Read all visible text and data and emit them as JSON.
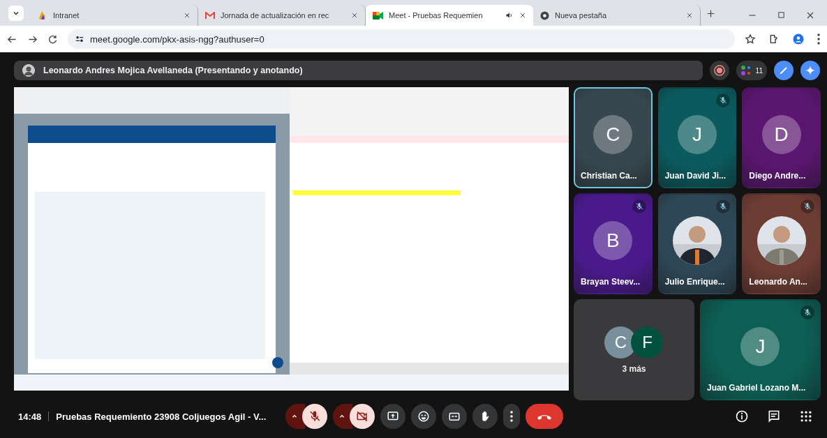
{
  "browser": {
    "tabs": [
      {
        "title": "Intranet",
        "selected": false,
        "audio": false
      },
      {
        "title": "Jornada de actualización en rec",
        "selected": false,
        "audio": false
      },
      {
        "title": "Meet - Pruebas Requemien",
        "selected": true,
        "audio": true
      },
      {
        "title": "Nueva pestaña",
        "selected": false,
        "audio": false
      }
    ],
    "url": "meet.google.com/pkx-asis-ngg?authuser=0"
  },
  "presenter_bar": {
    "text": "Leonardo Andres Mojica Avellaneda (Presentando y anotando)",
    "participant_count": "11"
  },
  "tiles": [
    {
      "name": "Christian Ca...",
      "kind": "avatar",
      "initial": "C",
      "color": "#37474f",
      "muted": false,
      "speaking": true
    },
    {
      "name": "Juan David Ji...",
      "kind": "avatar",
      "initial": "J",
      "color": "#0b5a5e",
      "muted": true,
      "speaking": false
    },
    {
      "name": "Diego Andre...",
      "kind": "avatar",
      "initial": "D",
      "color": "#5a1670",
      "muted": false,
      "speaking": false
    },
    {
      "name": "Brayan Steev...",
      "kind": "avatar",
      "initial": "B",
      "color": "#4a1a8c",
      "muted": true,
      "speaking": false
    },
    {
      "name": "Julio Enrique...",
      "kind": "picture",
      "color": "#2e4756",
      "muted": true,
      "speaking": false
    },
    {
      "name": "Leonardo An...",
      "kind": "picture",
      "color": "#6d3c33",
      "muted": true,
      "speaking": false
    }
  ],
  "more_tile": {
    "avatars": [
      {
        "initial": "C",
        "color": "#78909c"
      },
      {
        "initial": "F",
        "color": "#00523f"
      }
    ],
    "label": "3 más"
  },
  "wide_tile": {
    "name": "Juan Gabriel Lozano M...",
    "kind": "avatar",
    "initial": "J",
    "color": "#0d5f55",
    "muted": true,
    "speaking": false
  },
  "bottom_bar": {
    "time": "14:48",
    "meeting_title": "Pruebas Requemiento 23908 Coljuegos Agil - V...",
    "mic_on": false,
    "camera_on": false
  }
}
